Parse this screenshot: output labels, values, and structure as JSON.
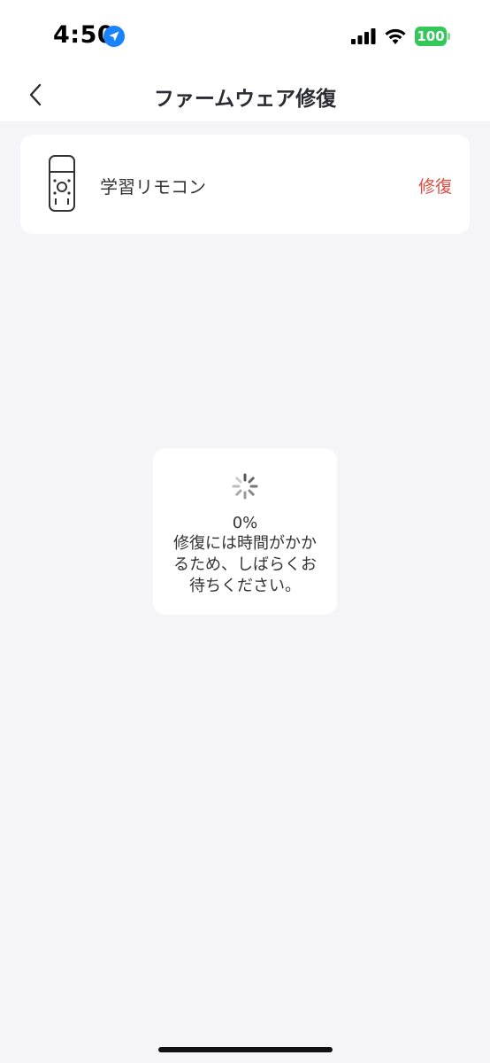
{
  "status_bar": {
    "time": "4:50",
    "battery": "100",
    "battery_color": "#34c759",
    "icons": [
      "location-arrow-icon",
      "cellular-signal-icon",
      "wifi-icon",
      "battery-icon"
    ]
  },
  "nav": {
    "title": "ファームウェア修復",
    "back_icon": "chevron-left-icon"
  },
  "device": {
    "icon": "remote-control-icon",
    "name": "学習リモコン",
    "action_label": "修復",
    "action_color": "#e04a3f"
  },
  "toast": {
    "icon": "spinner-icon",
    "progress": "0%",
    "message": "修復には時間がかかるため、しばらくお待ちください。"
  }
}
